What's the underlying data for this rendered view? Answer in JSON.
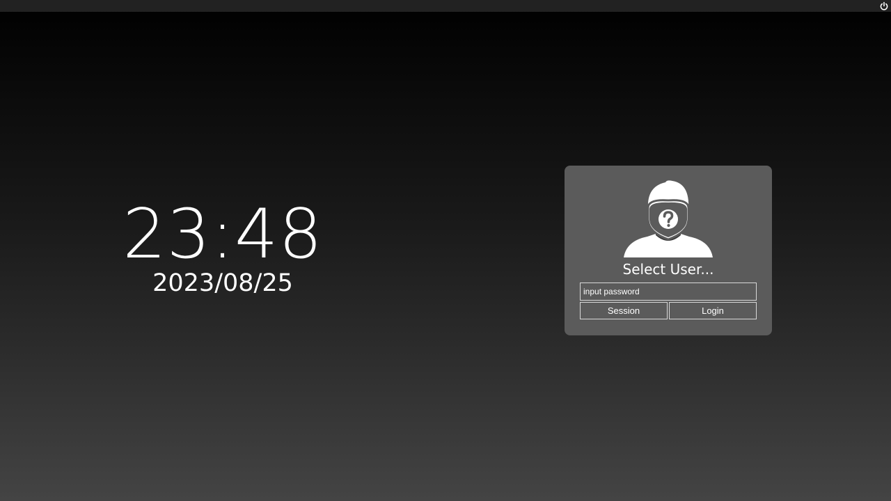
{
  "topbar": {
    "power_icon": "power-icon"
  },
  "clock": {
    "time": "23:48",
    "date": "2023/08/25"
  },
  "login": {
    "avatar_icon": "user-unknown-icon",
    "user_label": "Select User...",
    "password_placeholder": "input password",
    "password_value": "",
    "session_label": "Session",
    "login_label": "Login"
  },
  "colors": {
    "card_bg": "#5b5b5b",
    "topbar_bg": "#222222",
    "text": "#ffffff"
  }
}
